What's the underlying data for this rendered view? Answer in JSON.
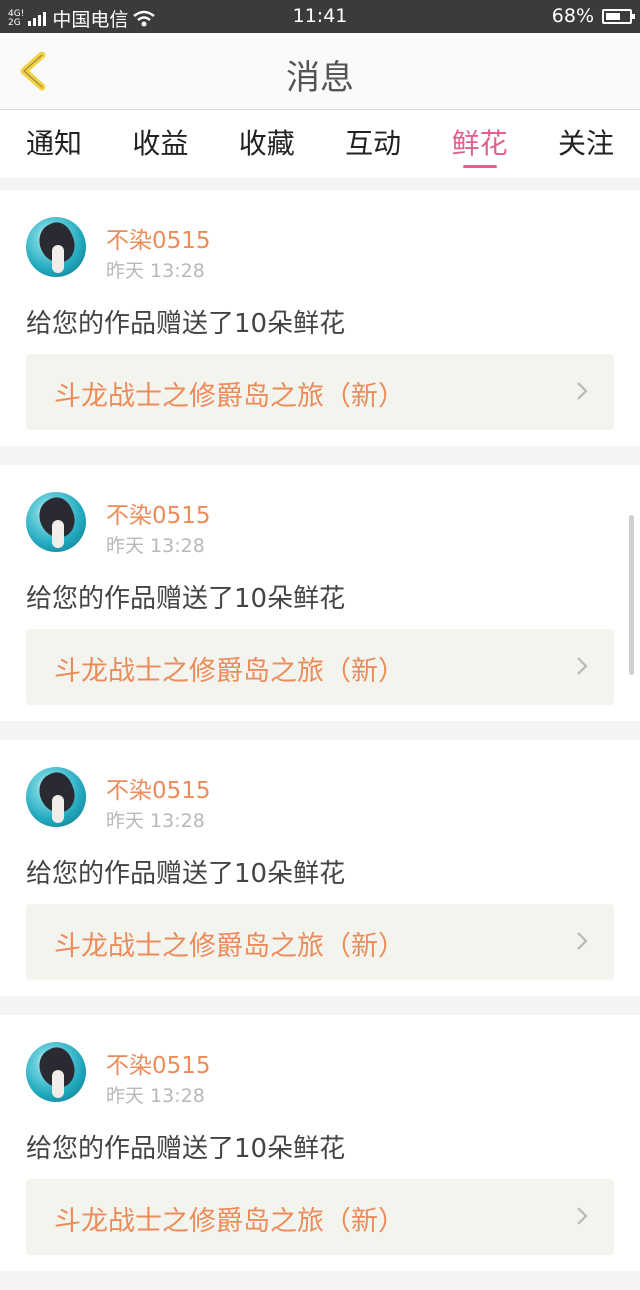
{
  "status_bar": {
    "network_top": "4G!",
    "network_bottom": "2G",
    "carrier": "中国电信",
    "time": "11:41",
    "battery": "68%",
    "battery_level": 0.68
  },
  "header": {
    "title": "消息"
  },
  "tabs": [
    {
      "label": "通知",
      "active": false
    },
    {
      "label": "收益",
      "active": false
    },
    {
      "label": "收藏",
      "active": false
    },
    {
      "label": "互动",
      "active": false
    },
    {
      "label": "鲜花",
      "active": true
    },
    {
      "label": "关注",
      "active": false
    }
  ],
  "messages": [
    {
      "user": "不染0515",
      "time": "昨天 13:28",
      "text": "给您的作品赠送了10朵鲜花",
      "work": "斗龙战士之修爵岛之旅（新）"
    },
    {
      "user": "不染0515",
      "time": "昨天 13:28",
      "text": "给您的作品赠送了10朵鲜花",
      "work": "斗龙战士之修爵岛之旅（新）"
    },
    {
      "user": "不染0515",
      "time": "昨天 13:28",
      "text": "给您的作品赠送了10朵鲜花",
      "work": "斗龙战士之修爵岛之旅（新）"
    },
    {
      "user": "不染0515",
      "time": "昨天 13:28",
      "text": "给您的作品赠送了10朵鲜花",
      "work": "斗龙战士之修爵岛之旅（新）"
    }
  ],
  "colors": {
    "accent_pink": "#e25f8e",
    "username_orange": "#ec8c5b",
    "back_icon_yellow": "#f4d142"
  }
}
